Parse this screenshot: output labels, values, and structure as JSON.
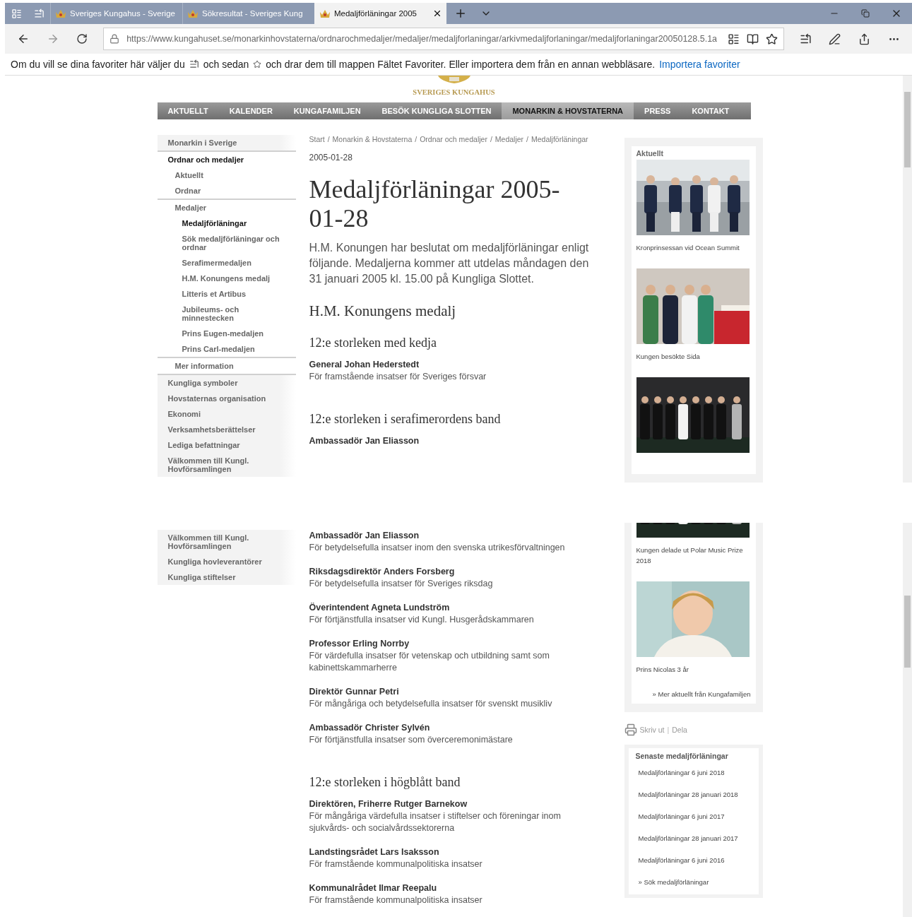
{
  "browser": {
    "tabs": [
      {
        "title": "Sveriges Kungahus - Sverige",
        "selected": false
      },
      {
        "title": "Sökresultat - Sveriges Kung",
        "selected": false
      },
      {
        "title": "Medaljförläningar 2005",
        "selected": true
      }
    ],
    "address": "https://www.kungahuset.se/monarkinhovstaterna/ordnarochmedaljer/medaljer/medaljforlaningar/arkivmedaljforlaningar/medaljforlaningar20050128.5.1a",
    "favorites_bar": {
      "text_1": "Om du vill se dina favoriter här väljer du",
      "text_2": "och sedan",
      "text_3": "och drar dem till mappen Fältet Favoriter. Eller importera dem från en annan webbläsare.",
      "link": "Importera favoriter"
    }
  },
  "views": [
    {
      "continued": false,
      "site_header": {
        "logo_text": "SVERIGES KUNGAHUS",
        "nav": [
          {
            "label": "AKTUELLT",
            "selected": false
          },
          {
            "label": "KALENDER",
            "selected": false
          },
          {
            "label": "KUNGAFAMILJEN",
            "selected": false
          },
          {
            "label": "BESÖK KUNGLIGA SLOTTEN",
            "selected": false
          },
          {
            "label": "MONARKIN & HOVSTATERNA",
            "selected": true
          },
          {
            "label": "PRESS",
            "selected": false
          },
          {
            "label": "KONTAKT",
            "selected": false
          }
        ]
      },
      "sidebar": [
        {
          "label": "Monarkin i Sverige",
          "selected": false
        },
        {
          "label": "Ordnar och medaljer",
          "selected": true,
          "children": [
            {
              "label": "Aktuellt",
              "selected": false
            },
            {
              "label": "Ordnar",
              "selected": false
            },
            {
              "label": "Medaljer",
              "selected": false,
              "children": [
                {
                  "label": "Medaljförläningar",
                  "selected": true
                },
                {
                  "label": "Sök medaljförläningar och ordnar",
                  "selected": false
                },
                {
                  "label": "Serafimermedaljen",
                  "selected": false
                },
                {
                  "label": "H.M. Konungens medalj",
                  "selected": false
                },
                {
                  "label": "Litteris et Artibus",
                  "selected": false
                },
                {
                  "label": "Jubileums- och minnestecken",
                  "selected": false
                },
                {
                  "label": "Prins Eugen-medaljen",
                  "selected": false
                },
                {
                  "label": "Prins Carl-medaljen",
                  "selected": false
                }
              ]
            },
            {
              "label": "Mer information",
              "selected": false
            }
          ]
        },
        {
          "label": "Kungliga symboler",
          "selected": false
        },
        {
          "label": "Hovstaternas organisation",
          "selected": false
        },
        {
          "label": "Ekonomi",
          "selected": false
        },
        {
          "label": "Verksamhetsberättelser",
          "selected": false
        },
        {
          "label": "Lediga befattningar",
          "selected": false
        },
        {
          "label": "Välkommen till Kungl. Hovförsamlingen",
          "selected": false
        }
      ],
      "breadcrumb_separator": "/",
      "breadcrumb": [
        "Start",
        "Monarkin & Hovstaterna",
        "Ordnar och medaljer",
        "Medaljer",
        "Medaljförläningar"
      ],
      "date": "2005-01-28",
      "title": "Medaljförläningar 2005-01-28",
      "intro": "H.M. Konungen har beslutat om medaljförläningar enligt följande. Medaljerna kommer att utdelas måndagen den 31 januari 2005 kl. 15.00 på Kungliga Slottet.",
      "content": [
        {
          "kind": "heading",
          "text": "H.M. Konungens medalj"
        },
        {
          "kind": "subheading",
          "text": "12:e storleken med kedja"
        },
        {
          "kind": "recipient",
          "name": "General Johan Hederstedt",
          "reason": "För framstående insatser för Sveriges försvar"
        },
        {
          "kind": "subheading",
          "text": "12:e storleken i serafimerordens band"
        },
        {
          "kind": "recipient",
          "name": "Ambassadör Jan Eliasson"
        }
      ],
      "aside": {
        "title": "Aktuellt",
        "news": [
          {
            "picture": {
              "kind": "picture"
            },
            "caption": "Kronprinsessan vid Ocean Summit"
          },
          {
            "picture": {
              "kind": "picture"
            },
            "caption": "Kungen besökte Sida"
          },
          {
            "picture": {
              "kind": "picture"
            }
          }
        ]
      }
    },
    {
      "continued": true,
      "sidebar": [
        {
          "label": "Välkommen till Kungl. Hovförsamlingen",
          "selected": false
        },
        {
          "label": "Kungliga hovleverantörer",
          "selected": false
        },
        {
          "label": "Kungliga stiftelser",
          "selected": false
        }
      ],
      "content": [
        {
          "kind": "recipient",
          "name": "Ambassadör Jan Eliasson",
          "reason": "För betydelsefulla insatser inom den svenska utrikesförvaltningen"
        },
        {
          "kind": "recipient",
          "name": "Riksdagsdirektör Anders Forsberg",
          "reason": "För betydelsefulla insatser för Sveriges riksdag"
        },
        {
          "kind": "recipient",
          "name": "Överintendent Agneta Lundström",
          "reason": "För förtjänstfulla insatser vid Kungl. Husgerådskammaren"
        },
        {
          "kind": "recipient",
          "name": "Professor Erling Norrby",
          "reason": "För värdefulla insatser för vetenskap och utbildning samt som kabinettskammarherre"
        },
        {
          "kind": "recipient",
          "name": "Direktör Gunnar Petri",
          "reason": "För mångåriga och betydelsefulla insatser för svenskt musikliv"
        },
        {
          "kind": "recipient",
          "name": "Ambassadör Christer Sylvén",
          "reason": "För förtjänstfulla insatser som överceremonimästare"
        },
        {
          "kind": "subheading",
          "text": "12:e storleken i högblått band"
        },
        {
          "kind": "recipient",
          "name": "Direktören, Friherre Rutger Barnekow",
          "reason": "För mångåriga värdefulla insatser i stiftelser och föreningar inom sjukvårds- och socialvårdssektorerna"
        },
        {
          "kind": "recipient",
          "name": "Landstingsrådet Lars Isaksson",
          "reason": "För framstående kommunalpolitiska insatser"
        },
        {
          "kind": "recipient",
          "name": "Kommunalrådet Ilmar Reepalu",
          "reason": "För framstående kommunalpolitiska insatser"
        }
      ],
      "aside": {
        "news": [
          {
            "picture": {
              "kind": "picture"
            },
            "caption": "Kungen delade ut Polar Music Prize 2018"
          },
          {
            "picture": {
              "kind": "picture"
            },
            "caption": "Prins Nicolas 3 år"
          }
        ],
        "more_link": "» Mer aktuellt från Kungafamiljen",
        "tools": {
          "print": "Skriv ut",
          "separator": "|",
          "share": "Dela"
        },
        "latest": {
          "title": "Senaste medaljförläningar",
          "items": [
            "Medaljförläningar 6 juni 2018",
            "Medaljförläningar 28 januari 2018",
            "Medaljförläningar 6 juni 2017",
            "Medaljförläningar 28 januari 2017",
            "Medaljförläningar 6 juni 2016"
          ],
          "search_link": "» Sök medaljförläningar"
        }
      }
    }
  ]
}
